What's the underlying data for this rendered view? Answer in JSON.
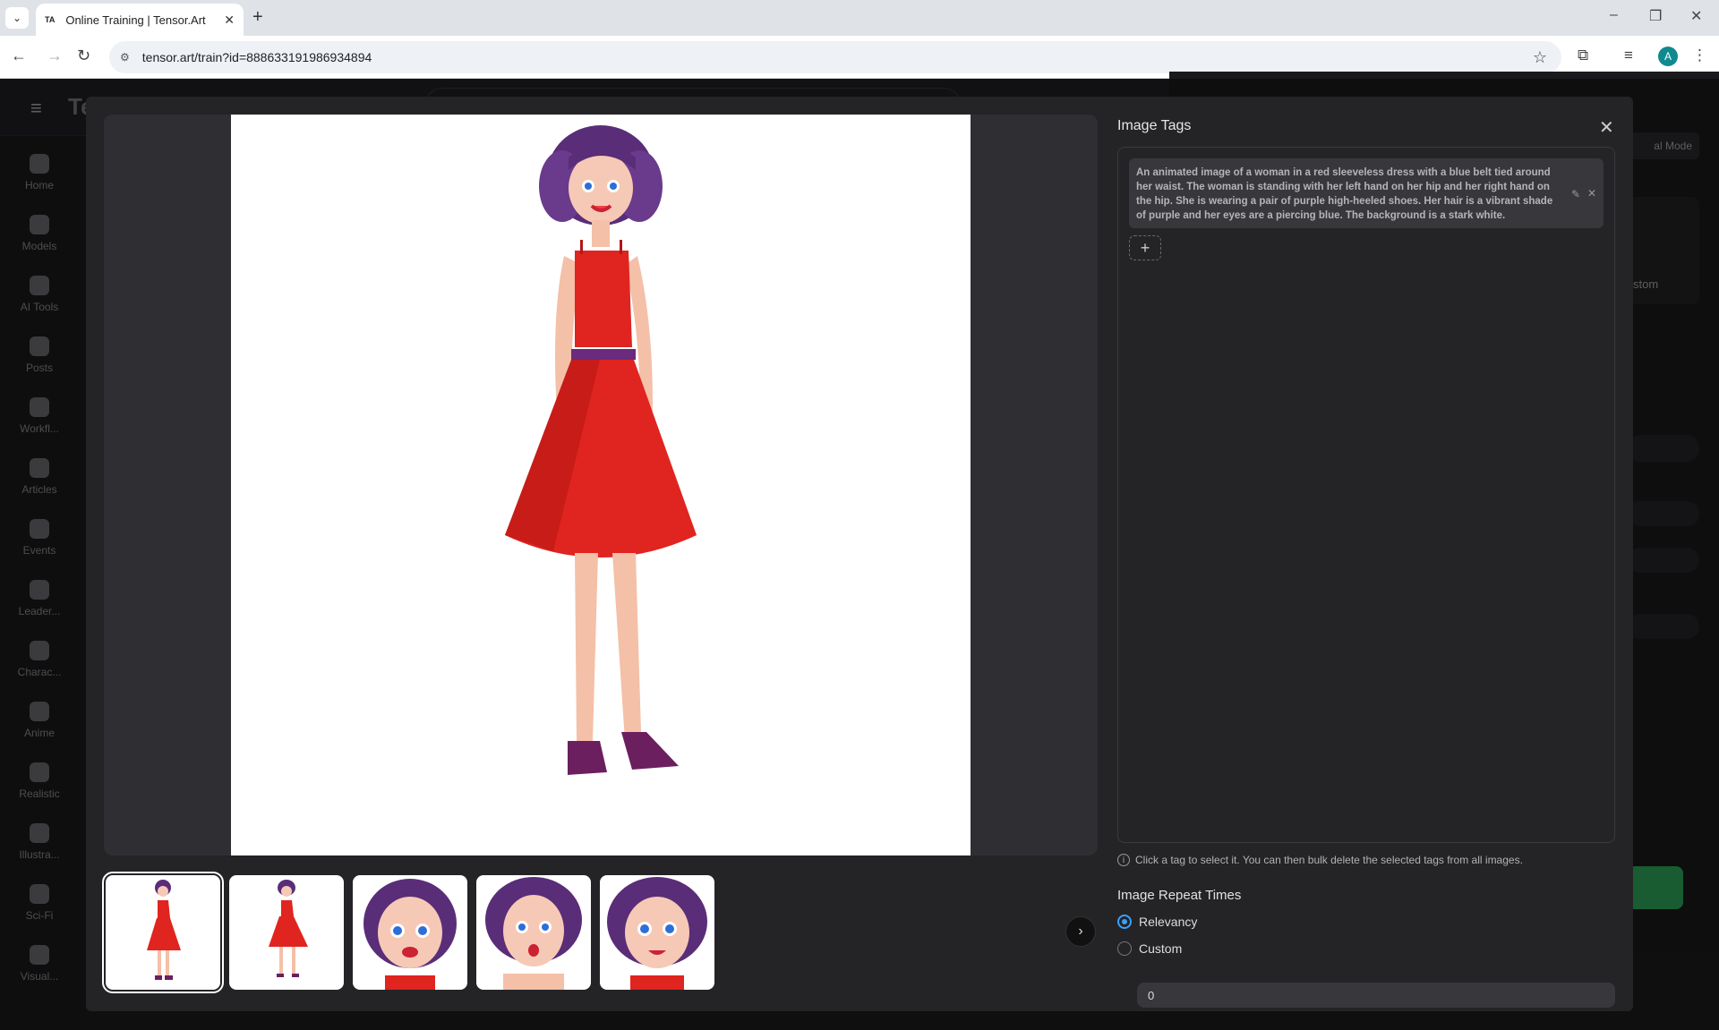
{
  "browser": {
    "tab_title": "Online Training | Tensor.Art",
    "tab_favicon": "TA",
    "url": "tensor.art/train?id=888633191986934894",
    "profile_initial": "A"
  },
  "sidebar": {
    "items": [
      {
        "label": "Home"
      },
      {
        "label": "Models"
      },
      {
        "label": "AI Tools"
      },
      {
        "label": "Posts"
      },
      {
        "label": "Workfl..."
      },
      {
        "label": "Articles"
      },
      {
        "label": "Events"
      },
      {
        "label": "Leader..."
      },
      {
        "label": "Charac..."
      },
      {
        "label": "Anime"
      },
      {
        "label": "Realistic"
      },
      {
        "label": "Illustra..."
      },
      {
        "label": "Sci-Fi"
      },
      {
        "label": "Visual..."
      }
    ]
  },
  "background": {
    "mode_button": "al Mode",
    "card_label": "stom"
  },
  "modal": {
    "title": "Image Tags",
    "tag_text": "An animated image of a woman in a red sleeveless dress with a blue belt tied around her waist. The woman is standing with her left hand on her hip and her right hand on the hip. She is wearing a pair of purple high-heeled shoes. Her hair is a vibrant shade of purple and her eyes are a piercing blue. The background is a stark white.",
    "add_tag": "+",
    "hint": "Click a tag to select it. You can then bulk delete the selected tags from all images.",
    "repeat_title": "Image Repeat Times",
    "options": [
      {
        "label": "Relevancy",
        "selected": true
      },
      {
        "label": "Custom",
        "selected": false
      }
    ],
    "custom_value": "0",
    "thumbnails": [
      {
        "subject": "full-body-red-dress-front",
        "active": true
      },
      {
        "subject": "full-body-red-dress-pose",
        "active": false
      },
      {
        "subject": "face-closeup-smile",
        "active": false
      },
      {
        "subject": "face-closeup-surprised",
        "active": false
      },
      {
        "subject": "face-closeup-happy",
        "active": false
      }
    ]
  },
  "colors": {
    "accent_blue": "#3aa0ff",
    "dress_red": "#e0241f",
    "hair_purple": "#5a2d78",
    "shoe_purple": "#6b1f5e",
    "create_green": "#2fa85c"
  }
}
